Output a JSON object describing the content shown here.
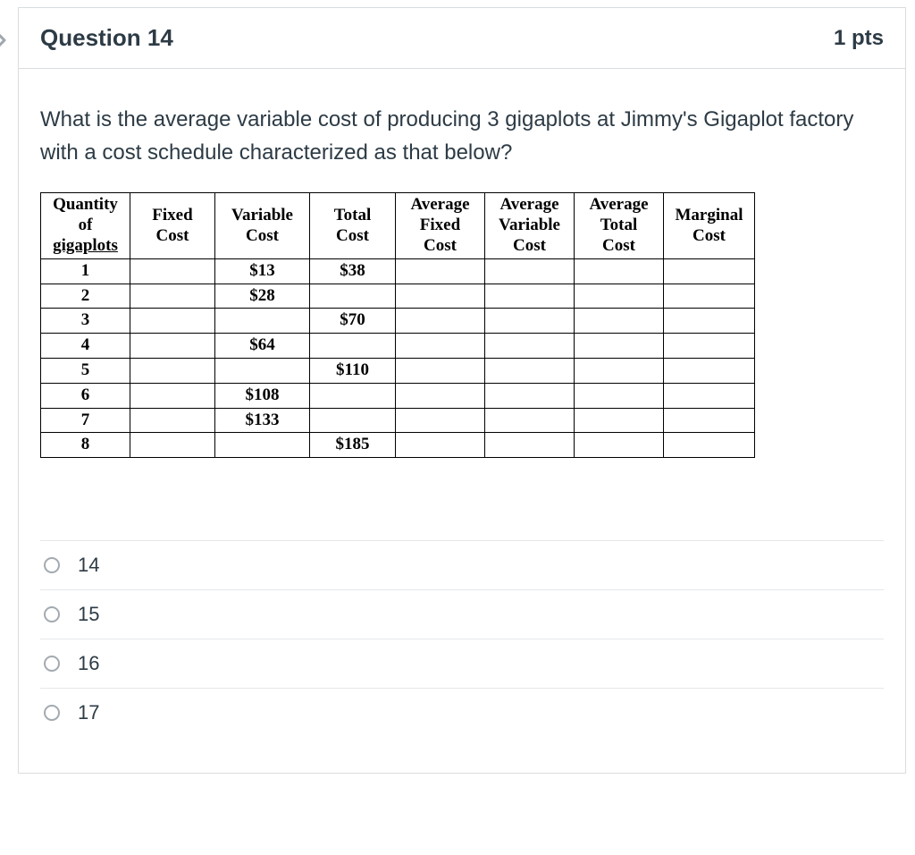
{
  "nav": {
    "chevron_icon": "chevron-right"
  },
  "header": {
    "title": "Question 14",
    "points": "1 pts"
  },
  "question": {
    "text": "What is the average variable cost of producing 3 gigaplots at Jimmy's Gigaplot factory  with a cost schedule characterized as that below?"
  },
  "table": {
    "headers": {
      "qty_l1": "Quantity",
      "qty_l2": "of",
      "qty_l3": "gigaplots",
      "fixed_l1": "Fixed",
      "fixed_l2": "Cost",
      "var_l1": "Variable",
      "var_l2": "Cost",
      "total_l1": "Total",
      "total_l2": "Cost",
      "afc_l1": "Average",
      "afc_l2": "Fixed",
      "afc_l3": "Cost",
      "avc_l1": "Average",
      "avc_l2": "Variable",
      "avc_l3": "Cost",
      "atc_l1": "Average",
      "atc_l2": "Total",
      "atc_l3": "Cost",
      "mc_l1": "Marginal",
      "mc_l2": "Cost"
    },
    "rows": [
      {
        "qty": "1",
        "fixed": "",
        "var": "$13",
        "total": "$38",
        "afc": "",
        "avc": "",
        "atc": "",
        "mc": ""
      },
      {
        "qty": "2",
        "fixed": "",
        "var": "$28",
        "total": "",
        "afc": "",
        "avc": "",
        "atc": "",
        "mc": ""
      },
      {
        "qty": "3",
        "fixed": "",
        "var": "",
        "total": "$70",
        "afc": "",
        "avc": "",
        "atc": "",
        "mc": ""
      },
      {
        "qty": "4",
        "fixed": "",
        "var": "$64",
        "total": "",
        "afc": "",
        "avc": "",
        "atc": "",
        "mc": ""
      },
      {
        "qty": "5",
        "fixed": "",
        "var": "",
        "total": "$110",
        "afc": "",
        "avc": "",
        "atc": "",
        "mc": ""
      },
      {
        "qty": "6",
        "fixed": "",
        "var": "$108",
        "total": "",
        "afc": "",
        "avc": "",
        "atc": "",
        "mc": ""
      },
      {
        "qty": "7",
        "fixed": "",
        "var": "$133",
        "total": "",
        "afc": "",
        "avc": "",
        "atc": "",
        "mc": ""
      },
      {
        "qty": "8",
        "fixed": "",
        "var": "",
        "total": "$185",
        "afc": "",
        "avc": "",
        "atc": "",
        "mc": ""
      }
    ]
  },
  "answers": [
    {
      "label": "14"
    },
    {
      "label": "15"
    },
    {
      "label": "16"
    },
    {
      "label": "17"
    }
  ]
}
